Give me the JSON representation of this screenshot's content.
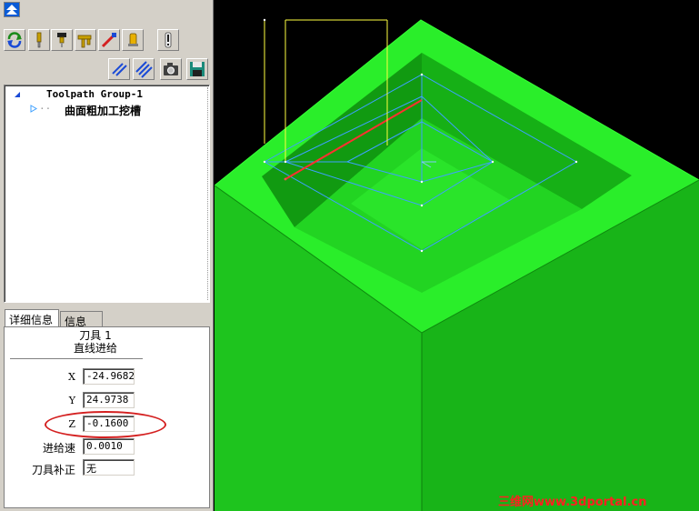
{
  "tree": {
    "group_label": "Toolpath Group-1",
    "operation_label": "曲面粗加工挖槽"
  },
  "tabs": {
    "details": "详细信息",
    "info": "信息"
  },
  "details": {
    "tool_line": "刀具 1",
    "move_type": "直线进给",
    "fields": [
      {
        "label": "X",
        "value": "-24.9682"
      },
      {
        "label": "Y",
        "value": "24.9738"
      },
      {
        "label": "Z",
        "value": "-0.1600"
      },
      {
        "label": "进给速",
        "value": "0.0010"
      },
      {
        "label": "刀具补正",
        "value": "无"
      }
    ]
  },
  "toolbar": {
    "icons": [
      "refresh-icon",
      "tool-icon",
      "holder-icon",
      "shank-icon",
      "toolpath-color-icon",
      "stock-icon",
      "alert-icon",
      "toolpath-display-icon",
      "toolpath-multi-icon",
      "camera-icon",
      "save-icon"
    ]
  },
  "watermark": "三维网www.3dportal.cn",
  "colors": {
    "model_green": "#22e122",
    "panel_gray": "#d4d0c8",
    "highlight_red": "#d42020",
    "toolpath_blue": "#3ea0ff",
    "retract_yellow": "#ffff40"
  }
}
